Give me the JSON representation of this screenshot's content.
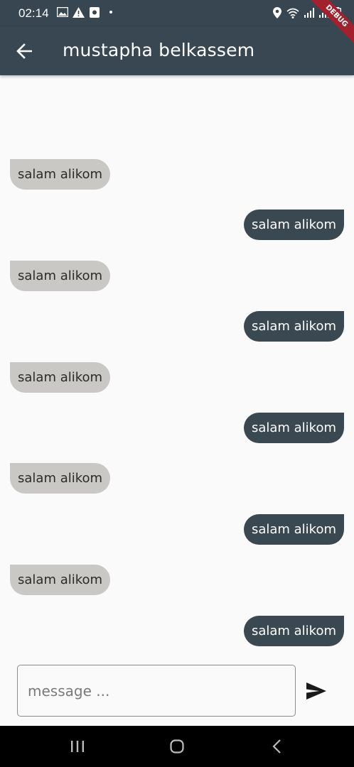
{
  "status_bar": {
    "time": "02:14",
    "icons": [
      "gallery-icon",
      "warning-icon",
      "app-icon",
      "dot-icon",
      "location-icon",
      "wifi-icon",
      "signal-icon",
      "signal-icon-2",
      "battery-icon"
    ]
  },
  "debug_banner": "DEBUG",
  "app_bar": {
    "title": "mustapha belkassem",
    "back_icon": "arrow-back-icon"
  },
  "messages": [
    {
      "text": "salam alikom",
      "type": "received"
    },
    {
      "text": "salam alikom",
      "type": "sent"
    },
    {
      "text": "salam alikom",
      "type": "received"
    },
    {
      "text": "salam alikom",
      "type": "sent"
    },
    {
      "text": "salam alikom",
      "type": "received"
    },
    {
      "text": "salam alikom",
      "type": "sent"
    },
    {
      "text": "salam alikom",
      "type": "received"
    },
    {
      "text": "salam alikom",
      "type": "sent"
    },
    {
      "text": "salam alikom",
      "type": "received"
    },
    {
      "text": "salam alikom",
      "type": "sent"
    }
  ],
  "composer": {
    "placeholder": "message ...",
    "value": "",
    "send_icon": "send-icon"
  },
  "nav_bar": {
    "items": [
      "recents-icon",
      "home-icon",
      "back-icon"
    ]
  },
  "colors": {
    "app_bar": "#384752",
    "sent_bubble": "#3a4851",
    "received_bubble": "#c9c8c5",
    "background": "#fafafa",
    "debug_ribbon": "#a3212c"
  }
}
